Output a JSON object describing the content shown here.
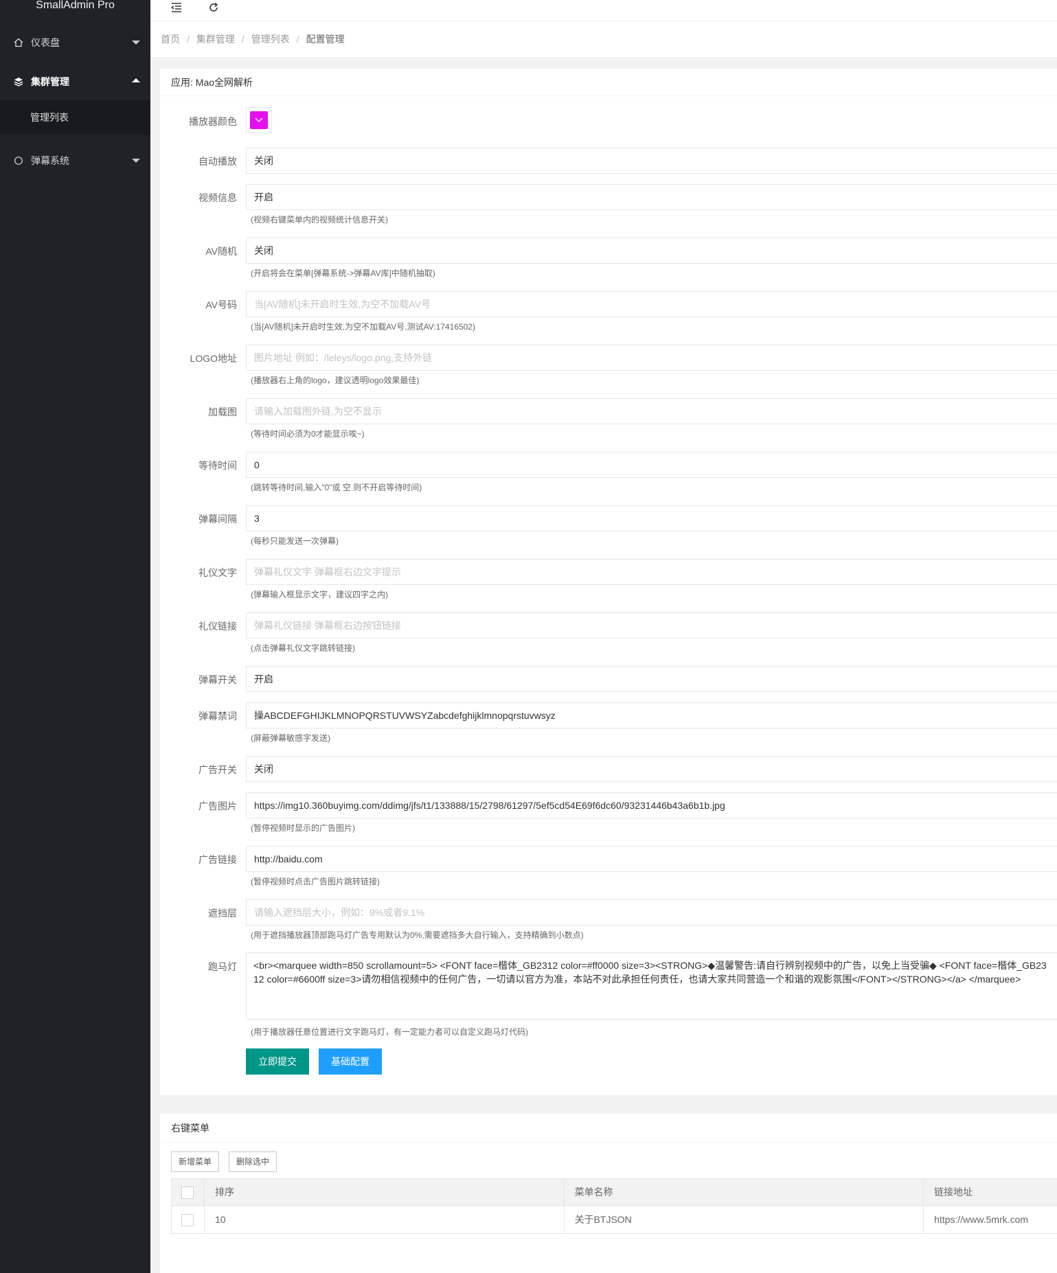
{
  "app": {
    "title": "SmallAdmin Pro"
  },
  "sidebar": {
    "items": [
      {
        "label": "仪表盘",
        "icon": "home-icon"
      },
      {
        "label": "集群管理",
        "icon": "layers-icon"
      },
      {
        "label": "弹幕系统",
        "icon": "circle-icon"
      }
    ],
    "subitems": [
      {
        "label": "管理列表"
      }
    ]
  },
  "header": {
    "tools": [
      "menu-fold-icon",
      "refresh-icon"
    ]
  },
  "breadcrumb": [
    "首页",
    "集群管理",
    "管理列表",
    "配置管理"
  ],
  "form": {
    "title": "应用: Mao全网解析",
    "player_color": {
      "label": "播放器颜色",
      "value": "#e60fef"
    },
    "autoplay": {
      "label": "自动播放",
      "value": "关闭"
    },
    "video_info": {
      "label": "视频信息",
      "value": "开启",
      "tip": "(视频右键菜单内的视频统计信息开关)"
    },
    "av_random": {
      "label": "AV随机",
      "value": "关闭",
      "tip": "(开启将会在菜单[弹幕系统->弹幕AV库]中随机抽取)"
    },
    "av_number": {
      "label": "AV号码",
      "value": "",
      "placeholder": "当[AV随机]未开启时生效,为空不加载AV号",
      "tip": "(当[AV随机]未开启时生效,为空不加载AV号,测试AV:17416502)"
    },
    "logo": {
      "label": "LOGO地址",
      "value": "",
      "placeholder": "图片地址 例如：/leleys/logo.png,支持外链",
      "tip": "(播放器右上角的logo，建议透明logo效果最佳)"
    },
    "loading_img": {
      "label": "加载图",
      "value": "",
      "placeholder": "请输入加载图外链,为空不显示",
      "tip": "(等待时间必须为0才能显示唉~)"
    },
    "wait_time": {
      "label": "等待时间",
      "value": "0",
      "tip": "(跳转等待时间,输入\"0\"或 空 则不开启等待时间)"
    },
    "danmaku_interval": {
      "label": "弹幕间隔",
      "value": "3",
      "tip": "(每秒只能发送一次弹幕)"
    },
    "gift_text": {
      "label": "礼仪文字",
      "value": "",
      "placeholder": "弹幕礼仪文字 弹幕框右边文字提示",
      "tip": "(弹幕输入框显示文字，建议四字之内)"
    },
    "gift_link": {
      "label": "礼仪链接",
      "value": "",
      "placeholder": "弹幕礼仪链接 弹幕框右边按钮链接",
      "tip": "(点击弹幕礼仪文字跳转链接)"
    },
    "danmaku_switch": {
      "label": "弹幕开关",
      "value": "开启"
    },
    "banned_words": {
      "label": "弹幕禁词",
      "value": "操ABCDEFGHIJKLMNOPQRSTUVWSYZabcdefghijklmnopqrstuvwsyz",
      "tip": "(屏蔽弹幕敏感字发送)"
    },
    "ad_switch": {
      "label": "广告开关",
      "value": "关闭"
    },
    "ad_image": {
      "label": "广告图片",
      "value": "https://img10.360buyimg.com/ddimg/jfs/t1/133888/15/2798/61297/5ef5cd54E69f6dc60/93231446b43a6b1b.jpg",
      "tip": "(暂停视频时显示的广告图片)"
    },
    "ad_link": {
      "label": "广告链接",
      "value": "http://baidu.com",
      "tip": "(暂停视频时点击广告图片跳转链接)"
    },
    "mask": {
      "label": "遮挡层",
      "value": "",
      "placeholder": "请输入遮挡层大小，例如：9%或者9.1%",
      "tip": "(用于遮挡播放器顶部跑马灯广告专用默认为0%,需要遮挡多大自行输入，支持精确到小数点)"
    },
    "marquee": {
      "label": "跑马灯",
      "value": "<br><marquee width=850 scrollamount=5> <FONT face=楷体_GB2312 color=#ff0000 size=3><STRONG>◆温馨警告:请自行辨别视频中的广告，以免上当受骗◆ <FONT face=楷体_GB2312 color=#6600ff size=3>请勿相信视频中的任何广告，一切请以官方为准，本站不对此承担任何责任，也请大家共同营造一个和谐的观影氛围</FONT></STRONG></a> </marquee>",
      "tip": "(用于播放器任意位置进行文字跑马灯，有一定能力者可以自定义跑马灯代码)"
    },
    "submit_label": "立即提交",
    "basic_label": "基础配置"
  },
  "context_menu": {
    "title": "右键菜单",
    "add_label": "新增菜单",
    "delete_label": "删除选中",
    "columns": [
      "排序",
      "菜单名称",
      "链接地址"
    ],
    "rows": [
      {
        "order": "10",
        "name": "关于BTJSON",
        "url": "https://www.5mrk.com"
      }
    ]
  }
}
